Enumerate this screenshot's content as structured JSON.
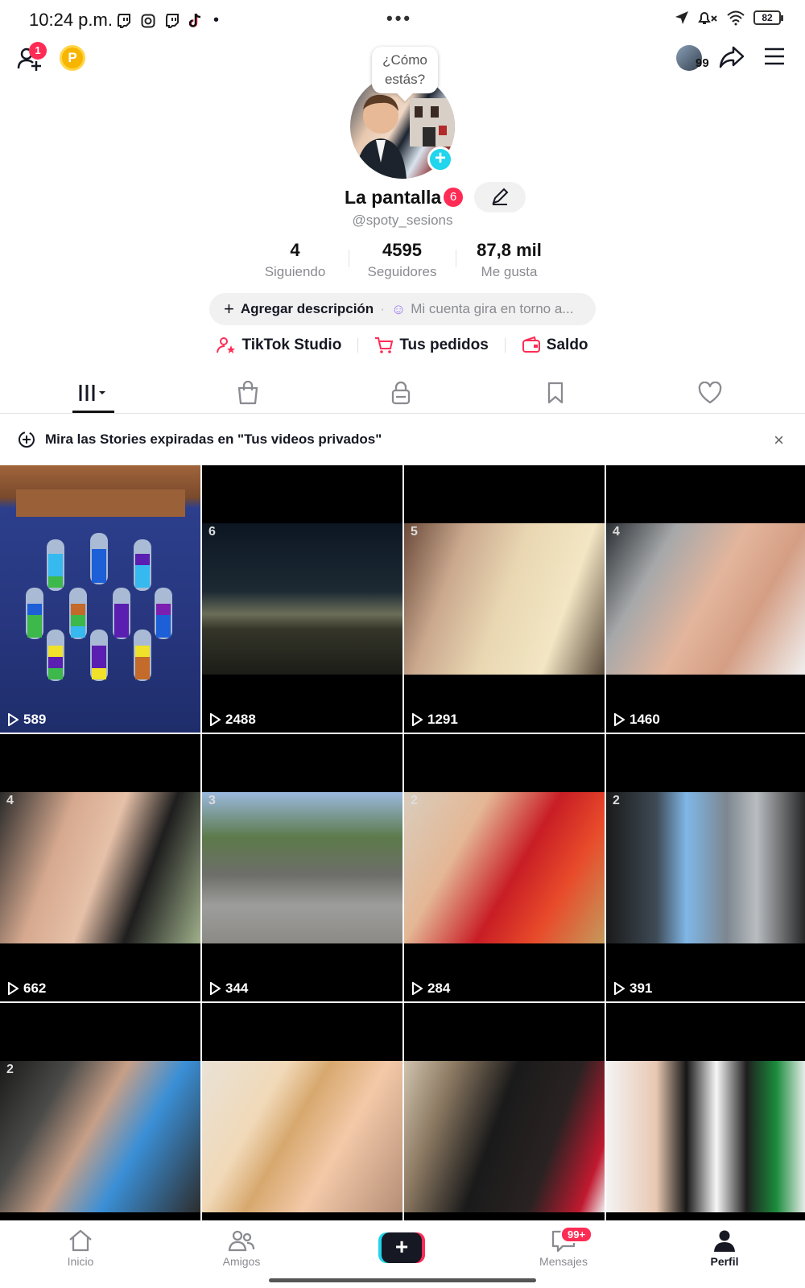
{
  "status_bar": {
    "time": "10:24 p.m.",
    "battery": "82",
    "notification_icons": [
      "twitch-icon",
      "instagram-icon",
      "twitch-icon",
      "tiktok-icon"
    ]
  },
  "header": {
    "add_friends_badge": "1",
    "coin_label": "P",
    "story_count": "99"
  },
  "profile": {
    "bubble_text": "¿Cómo estás?",
    "name": "La pantalla",
    "name_badge": "6",
    "username": "@spoty_sesions",
    "stats": [
      {
        "value": "4",
        "label": "Siguiendo"
      },
      {
        "value": "4595",
        "label": "Seguidores"
      },
      {
        "value": "87,8 mil",
        "label": "Me gusta"
      }
    ],
    "add_description": "Agregar descripción",
    "description_hint": "Mi cuenta gira en torno a..."
  },
  "quick_links": [
    {
      "label": "TikTok Studio",
      "icon": "studio-icon"
    },
    {
      "label": "Tus pedidos",
      "icon": "cart-icon"
    },
    {
      "label": "Saldo",
      "icon": "wallet-icon"
    }
  ],
  "tabs": [
    "videos-tab",
    "shop-tab",
    "private-tab",
    "saved-tab",
    "liked-tab"
  ],
  "banner": {
    "text": "Mira las Stories expiradas en \"Tus videos privados\"",
    "close": "×"
  },
  "videos": [
    {
      "views": "589",
      "pin": ""
    },
    {
      "views": "2488",
      "pin": "6"
    },
    {
      "views": "1291",
      "pin": "5"
    },
    {
      "views": "1460",
      "pin": "4"
    },
    {
      "views": "662",
      "pin": "4"
    },
    {
      "views": "344",
      "pin": "3"
    },
    {
      "views": "284",
      "pin": "2"
    },
    {
      "views": "391",
      "pin": "2"
    },
    {
      "views": "",
      "pin": "2"
    },
    {
      "views": "",
      "pin": ""
    },
    {
      "views": "",
      "pin": ""
    },
    {
      "views": "",
      "pin": ""
    }
  ],
  "bottom_nav": {
    "home": "Inicio",
    "friends": "Amigos",
    "messages": "Mensajes",
    "messages_badge": "99+",
    "profile": "Perfil",
    "create": "+"
  },
  "colors": {
    "accent_red": "#fe2c55",
    "accent_cyan": "#20d5ec",
    "text": "#161823",
    "muted": "#8a8b91"
  }
}
